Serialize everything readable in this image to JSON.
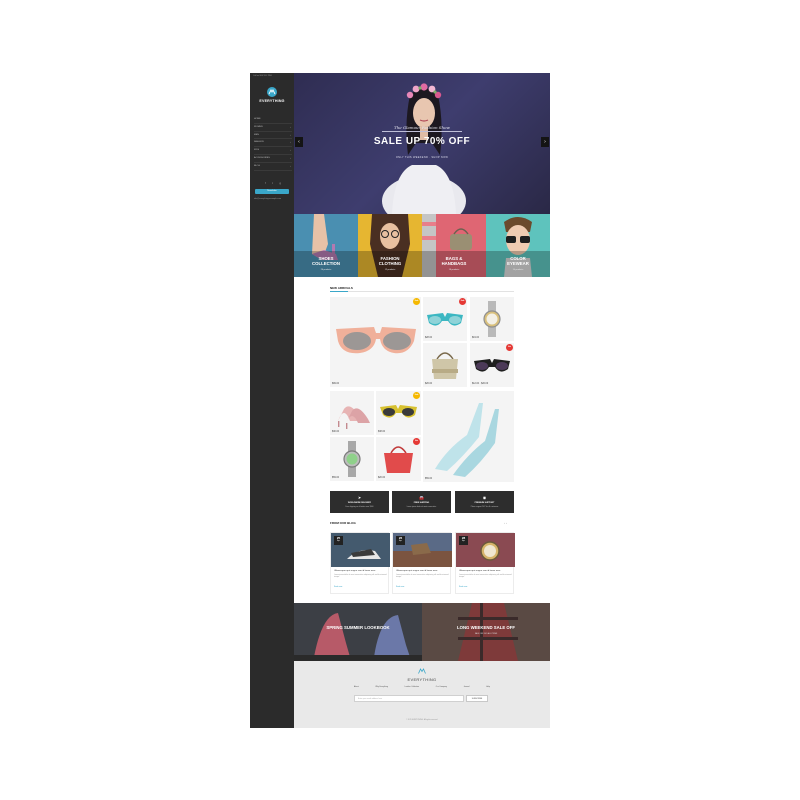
{
  "sidebar": {
    "top_note": "Call us 800 555 7890",
    "logo_text": "EVERYTHING",
    "nav": [
      {
        "label": "Home",
        "chevron": false
      },
      {
        "label": "Women",
        "chevron": true
      },
      {
        "label": "Men",
        "chevron": true
      },
      {
        "label": "Fashion",
        "chevron": true
      },
      {
        "label": "Kids",
        "chevron": true
      },
      {
        "label": "Accessories",
        "chevron": true
      },
      {
        "label": "Blog",
        "chevron": true
      }
    ],
    "social": [
      "f",
      "t",
      "g"
    ],
    "newsletter_button": "Newsletter",
    "email": "info@everything-example.com"
  },
  "hero": {
    "subtitle": "The Glamour Fashion Show",
    "title": "SALE UP 70% OFF",
    "tagline": "ONLY THIS WEEKEND · SHOP NOW",
    "prev": "‹",
    "next": "›"
  },
  "categories": [
    {
      "label_line1": "SHOES",
      "label_line2": "COLLECTION",
      "count": "26 products"
    },
    {
      "label_line1": "FASHION",
      "label_line2": "CLOTHING",
      "count": "12 products"
    },
    {
      "label_line1": "BAGS &",
      "label_line2": "HANDBAGS",
      "count": "18 products"
    },
    {
      "label_line1": "COLOR",
      "label_line2": "EYEWEAR",
      "count": "10 products"
    }
  ],
  "arrivals": {
    "title": "NEW ARRIVALS",
    "products": [
      {
        "price": "$99.00",
        "badge": "Sale",
        "badge_color": "#f5b800"
      },
      {
        "price": "$28.00",
        "badge": "Sale",
        "badge_color": "#e53935"
      },
      {
        "price": "$19.00",
        "badge": "",
        "badge_color": ""
      },
      {
        "price": "$26.00",
        "badge": "",
        "badge_color": ""
      },
      {
        "price": "$12.00 · $20.00",
        "badge": "Hot",
        "badge_color": "#e53935"
      },
      {
        "price": "$30.00",
        "badge": "",
        "badge_color": ""
      },
      {
        "price": "$38.00",
        "badge": "Sale",
        "badge_color": "#f5b800"
      },
      {
        "price": "$59.00",
        "badge": "",
        "badge_color": ""
      },
      {
        "price": "$20.00",
        "badge": "Hot",
        "badge_color": "#e53935"
      },
      {
        "price": "$59.00",
        "badge": "",
        "badge_color": ""
      }
    ]
  },
  "features": [
    {
      "icon": "➤",
      "title": "WORLDWIDE DELIVERY",
      "desc": "Free shipping on all orders over $100"
    },
    {
      "icon": "🚘",
      "title": "FREE SHIPPING",
      "desc": "Lorem ipsum dolor sit amet consectetur"
    },
    {
      "icon": "◉",
      "title": "PREMIUM SUPPORT",
      "desc": "Phone support 24/7 for all customers"
    }
  ],
  "blog": {
    "title": "FROM OUR BLOG",
    "nav": "‹ ›",
    "posts": [
      {
        "day": "25",
        "month": "Apr",
        "title": "Ullamcorper quis augue sem id lorem nunc",
        "meta": "Lorem ipsum dolor sit amet consectetur adipiscing elit sed do eiusmod tempor",
        "more": "Read more"
      },
      {
        "day": "26",
        "month": "Apr",
        "title": "Ullamcorper quis augue sem id lorem nunc",
        "meta": "Lorem ipsum dolor sit amet consectetur adipiscing elit sed do eiusmod tempor",
        "more": "Read more"
      },
      {
        "day": "28",
        "month": "Apr",
        "title": "Ullamcorper quis augue sem id lorem nunc",
        "meta": "Lorem ipsum dolor sit amet consectetur adipiscing elit sed do eiusmod tempor",
        "more": "Read more"
      }
    ]
  },
  "banners": [
    {
      "title": "SPRING SUMMER LOOKBOOK",
      "sub": ""
    },
    {
      "title": "LONG WEEKEND SALE OFF",
      "sub": "SALE OFF 50% ALL ITEMS"
    }
  ],
  "footer": {
    "logo_text": "EVERYTHING",
    "links": [
      "About",
      "Why Everything",
      "Leather Collection",
      "Our Company",
      "Journal",
      "Help"
    ],
    "input_placeholder": "Enter your email address here",
    "subscribe": "SUBSCRIBE",
    "copyright": "© 2015 EVERYTHING. All rights reserved."
  },
  "colors": {
    "accent": "#3aa7c9",
    "sidebar_bg": "#2b2b2b",
    "hero_bg": "#35335e",
    "feature_bg": "#2d2d2d",
    "footer_bg": "#e9e9e9"
  }
}
